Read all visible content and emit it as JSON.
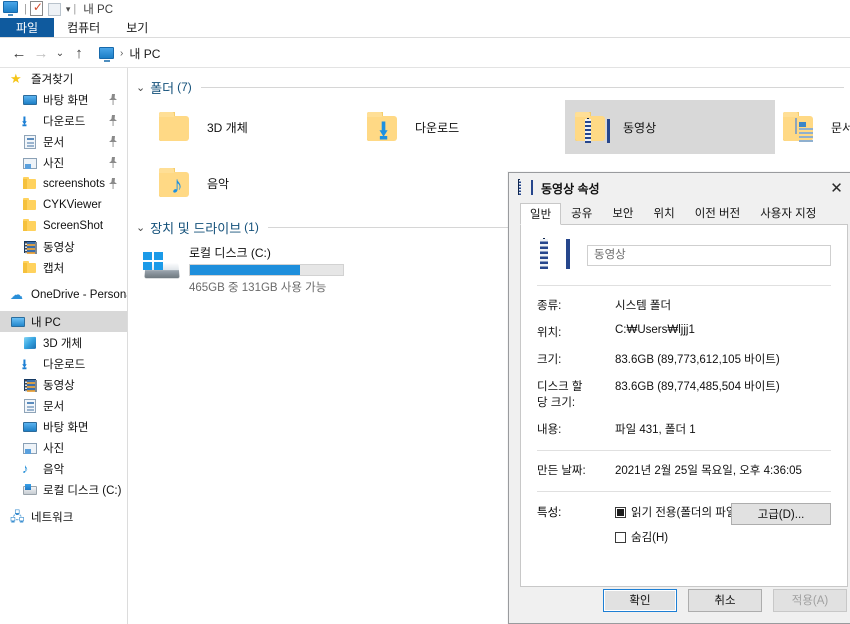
{
  "window": {
    "title": "내 PC",
    "quick_access_icons": [
      "monitor-icon",
      "properties-icon",
      "new-folder-icon",
      "dropdown-caret-icon"
    ],
    "ribbon_tabs": [
      {
        "label": "파일",
        "active": true
      },
      {
        "label": "컴퓨터",
        "active": false
      },
      {
        "label": "보기",
        "active": false
      }
    ]
  },
  "addressbar": {
    "back_icon": "back-arrow-icon",
    "forward_icon": "forward-arrow-icon",
    "recent_icon": "recent-locations-icon",
    "up_icon": "up-arrow-icon",
    "path_icon": "this-pc-icon",
    "path_text": "내 PC",
    "separator": "›"
  },
  "sidebar": {
    "items": [
      {
        "label": "즐겨찾기",
        "icon": "star-icon",
        "indent": 0,
        "pinned": false,
        "selected": false
      },
      {
        "label": "바탕 화면",
        "icon": "desktop-icon",
        "indent": 1,
        "pinned": true,
        "selected": false
      },
      {
        "label": "다운로드",
        "icon": "download-icon",
        "indent": 1,
        "pinned": true,
        "selected": false
      },
      {
        "label": "문서",
        "icon": "documents-icon",
        "indent": 1,
        "pinned": true,
        "selected": false
      },
      {
        "label": "사진",
        "icon": "pictures-icon",
        "indent": 1,
        "pinned": true,
        "selected": false
      },
      {
        "label": "screenshots",
        "icon": "folder-icon",
        "indent": 1,
        "pinned": true,
        "selected": false
      },
      {
        "label": "CYKViewer",
        "icon": "folder-icon",
        "indent": 1,
        "pinned": false,
        "selected": false
      },
      {
        "label": "ScreenShot",
        "icon": "folder-icon",
        "indent": 1,
        "pinned": false,
        "selected": false
      },
      {
        "label": "동영상",
        "icon": "videos-icon",
        "indent": 1,
        "pinned": false,
        "selected": false
      },
      {
        "label": "캡처",
        "icon": "folder-icon",
        "indent": 1,
        "pinned": false,
        "selected": false
      },
      {
        "label": "OneDrive - Personal",
        "icon": "cloud-icon",
        "indent": 0,
        "pinned": false,
        "selected": false
      },
      {
        "label": "내 PC",
        "icon": "this-pc-icon",
        "indent": 0,
        "pinned": false,
        "selected": true
      },
      {
        "label": "3D 개체",
        "icon": "3d-objects-icon",
        "indent": 1,
        "pinned": false,
        "selected": false
      },
      {
        "label": "다운로드",
        "icon": "download-icon",
        "indent": 1,
        "pinned": false,
        "selected": false
      },
      {
        "label": "동영상",
        "icon": "videos-icon",
        "indent": 1,
        "pinned": false,
        "selected": false
      },
      {
        "label": "문서",
        "icon": "documents-icon",
        "indent": 1,
        "pinned": false,
        "selected": false
      },
      {
        "label": "바탕 화면",
        "icon": "desktop-icon",
        "indent": 1,
        "pinned": false,
        "selected": false
      },
      {
        "label": "사진",
        "icon": "pictures-icon",
        "indent": 1,
        "pinned": false,
        "selected": false
      },
      {
        "label": "음악",
        "icon": "music-icon",
        "indent": 1,
        "pinned": false,
        "selected": false
      },
      {
        "label": "로컬 디스크 (C:)",
        "icon": "drive-icon",
        "indent": 1,
        "pinned": false,
        "selected": false
      },
      {
        "label": "네트워크",
        "icon": "network-icon",
        "indent": 0,
        "pinned": false,
        "selected": false
      }
    ]
  },
  "content": {
    "groups": [
      {
        "title": "폴더",
        "count": "(7)",
        "chevron": "chevron-down-icon"
      },
      {
        "title": "장치 및 드라이브",
        "count": "(1)",
        "chevron": "chevron-down-icon"
      }
    ],
    "folders": [
      {
        "label": "3D 개체",
        "emblem": "3d-objects-emblem",
        "selected": false
      },
      {
        "label": "다운로드",
        "emblem": "download-emblem",
        "selected": false
      },
      {
        "label": "동영상",
        "emblem": "videos-emblem",
        "selected": true
      },
      {
        "label": "문서",
        "emblem": "documents-emblem",
        "selected": false
      },
      {
        "label": "음악",
        "emblem": "music-emblem",
        "selected": false
      }
    ],
    "drives": [
      {
        "name": "로컬 디스크 (C:)",
        "capacity_text": "465GB 중 131GB 사용 가능",
        "used_percent": 72,
        "bar_color": "#1e8fdc",
        "icon": "windows-drive-icon"
      }
    ]
  },
  "dialog": {
    "title": "동영상 속성",
    "title_icon": "videos-folder-icon",
    "close_icon": "close-icon",
    "tabs": [
      {
        "label": "일반",
        "active": true
      },
      {
        "label": "공유",
        "active": false
      },
      {
        "label": "보안",
        "active": false
      },
      {
        "label": "위치",
        "active": false
      },
      {
        "label": "이전 버전",
        "active": false
      },
      {
        "label": "사용자 지정",
        "active": false
      }
    ],
    "name_value": "동영상",
    "fields": [
      {
        "key": "종류:",
        "value": "시스템 폴더"
      },
      {
        "key": "위치:",
        "value": "C:₩Users₩ljjj1"
      },
      {
        "key": "크기:",
        "value": "83.6GB (89,773,612,105 바이트)"
      },
      {
        "key": "디스크 할\n당 크기:",
        "value": "83.6GB (89,774,485,504 바이트)"
      },
      {
        "key": "내용:",
        "value": "파일 431, 폴더 1"
      }
    ],
    "created": {
      "key": "만든 날짜:",
      "value": "2021년 2월 25일 목요일, 오후 4:36:05"
    },
    "attributes": {
      "key": "특성:",
      "readonly": {
        "label": "읽기 전용(폴더의 파일에만 적용)(R)",
        "state": "indeterminate"
      },
      "hidden": {
        "label": "숨김(H)",
        "state": "unchecked"
      },
      "advanced_button": "고급(D)..."
    },
    "buttons": [
      {
        "label": "확인",
        "style": "primary",
        "disabled": false
      },
      {
        "label": "취소",
        "style": "normal",
        "disabled": false
      },
      {
        "label": "적용(A)",
        "style": "normal",
        "disabled": true
      }
    ]
  }
}
